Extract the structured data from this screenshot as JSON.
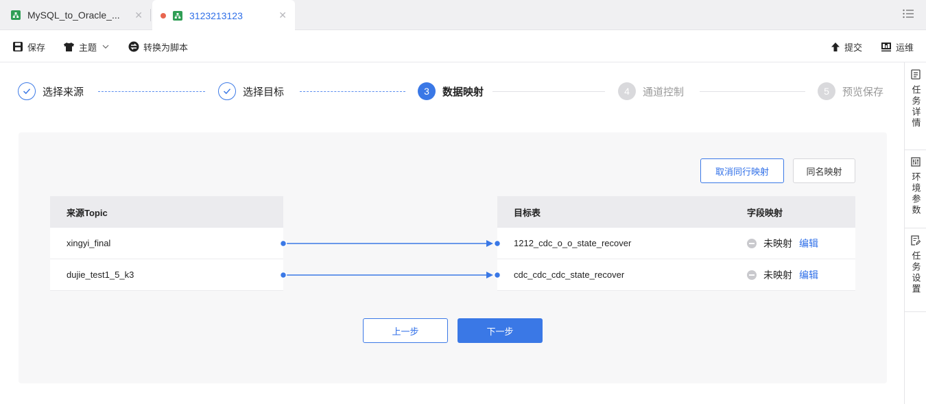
{
  "tabs": [
    {
      "label": "MySQL_to_Oracle_...",
      "active": false
    },
    {
      "label": "3123213123",
      "active": true
    }
  ],
  "toolbar": {
    "save": "保存",
    "theme": "主题",
    "convert": "转换为脚本",
    "submit": "提交",
    "ops": "运维"
  },
  "sidebar": [
    {
      "label": "任务详情",
      "icon": "document-icon"
    },
    {
      "label": "环境参数",
      "icon": "parameters-icon"
    },
    {
      "label": "任务设置",
      "icon": "settings-edit-icon"
    }
  ],
  "steps": [
    {
      "label": "选择来源",
      "state": "done",
      "number": ""
    },
    {
      "label": "选择目标",
      "state": "done",
      "number": ""
    },
    {
      "label": "数据映射",
      "state": "active",
      "number": "3"
    },
    {
      "label": "通道控制",
      "state": "pending",
      "number": "4"
    },
    {
      "label": "预览保存",
      "state": "pending",
      "number": "5"
    }
  ],
  "mapping": {
    "cancel_row_mapping": "取消同行映射",
    "same_name_mapping": "同名映射",
    "source_header": "来源Topic",
    "target_header": "目标表",
    "field_header": "字段映射",
    "rows": [
      {
        "source": "xingyi_final",
        "target": "1212_cdc_o_o_state_recover",
        "status": "未映射",
        "edit": "编辑"
      },
      {
        "source": "dujie_test1_5_k3",
        "target": "cdc_cdc_cdc_state_recover",
        "status": "未映射",
        "edit": "编辑"
      }
    ],
    "prev": "上一步",
    "next": "下一步"
  },
  "colors": {
    "accent": "#3a78e6",
    "tab_icon": "#2f9e55",
    "unsaved_dot": "#e8664f"
  }
}
